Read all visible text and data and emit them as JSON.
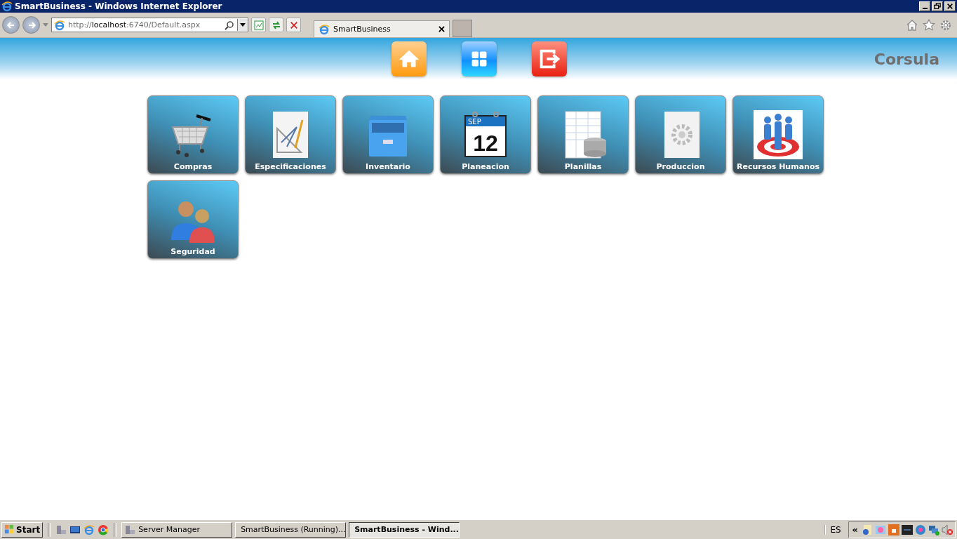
{
  "window": {
    "title": "SmartBusiness - Windows Internet Explorer"
  },
  "address_bar": {
    "url": "http://**localhost**:6740/Default.aspx"
  },
  "browser_tab": {
    "label": "SmartBusiness",
    "selected": true
  },
  "header": {
    "nav": [
      {
        "kind": "home"
      },
      {
        "kind": "apps"
      },
      {
        "kind": "logout"
      }
    ],
    "brand": "Corsula"
  },
  "tiles": [
    {
      "label": "Compras",
      "kind": "cart"
    },
    {
      "label": "Especificaciones",
      "kind": "drafting"
    },
    {
      "label": "Inventario",
      "kind": "cabinet"
    },
    {
      "label": "Planeacion",
      "kind": "calendar",
      "month": "SEP",
      "day": "12"
    },
    {
      "label": "Planillas",
      "kind": "sheet"
    },
    {
      "label": "Produccion",
      "kind": "gear"
    },
    {
      "label": "Recursos Humanos",
      "kind": "target"
    },
    {
      "label": "Seguridad",
      "kind": "users"
    }
  ],
  "taskbar": {
    "start": "Start",
    "tasks": [
      {
        "label": "Server Manager",
        "kind": "server",
        "selected": false
      },
      {
        "label": "SmartBusiness (Running)...",
        "kind": "vs",
        "selected": false
      },
      {
        "label": "SmartBusiness - Wind...",
        "kind": "ie",
        "selected": true
      }
    ],
    "language": "ES",
    "tray_toggle": "«"
  }
}
